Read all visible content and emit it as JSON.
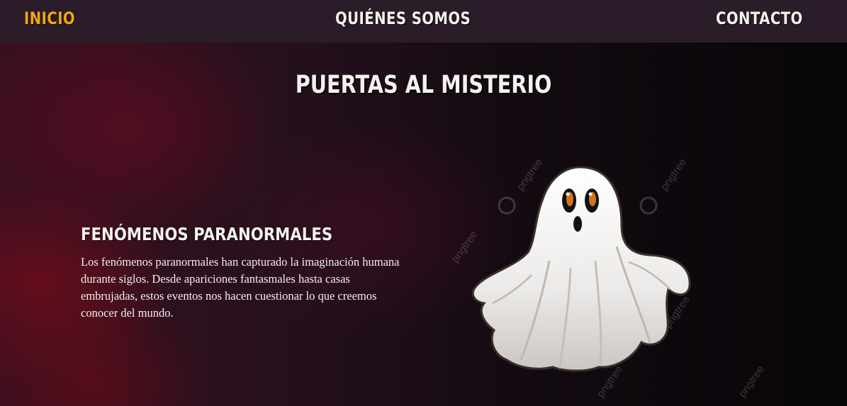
{
  "nav": {
    "items": [
      {
        "label": "INICIO",
        "active": true
      },
      {
        "label": "QUIÉNES SOMOS",
        "active": false
      },
      {
        "label": "CONTACTO",
        "active": false
      }
    ]
  },
  "hero": {
    "title": "PUERTAS AL MISTERIO"
  },
  "section": {
    "title": "FENÓMENOS PARANORMALES",
    "text": "Los fenómenos paranormales han capturado la imaginación humana durante siglos. Desde apariciones fantasmales hasta casas embrujadas, estos eventos nos hacen cuestionar lo que creemos conocer del mundo."
  },
  "image": {
    "watermark": "pngtree"
  },
  "colors": {
    "nav_bg": "#2b1c29",
    "accent": "#f2a812",
    "text": "#f5f1ee"
  }
}
